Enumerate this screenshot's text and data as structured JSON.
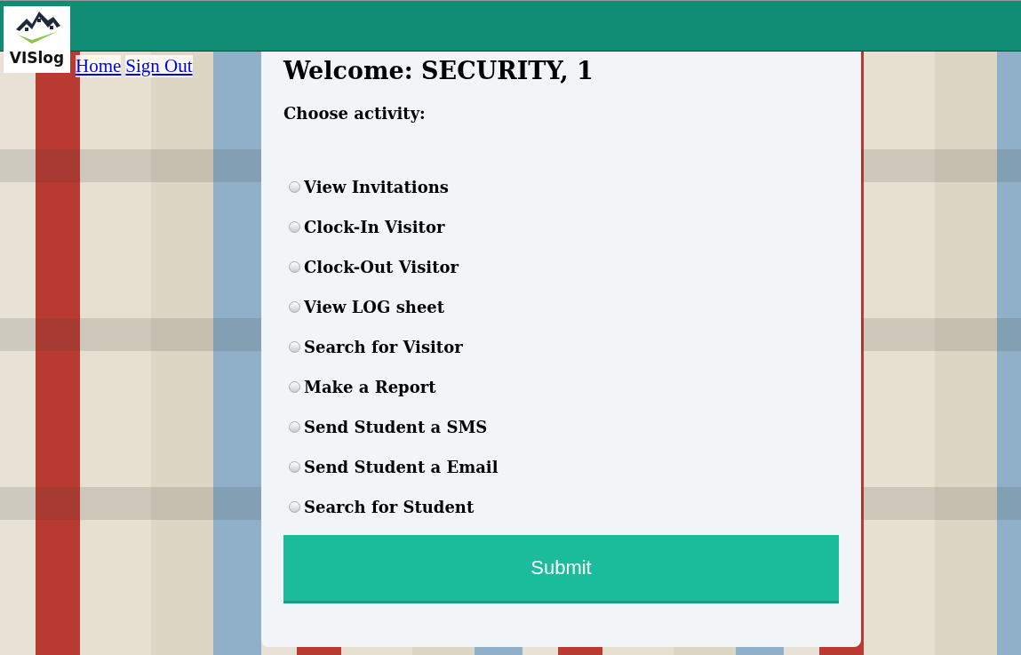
{
  "logo": {
    "text": "VISlog"
  },
  "nav_links": [
    "Home",
    "Sign Out"
  ],
  "welcome": "Welcome: SECURITY, 1",
  "prompt": "Choose activity:",
  "activities": [
    {
      "label": "View Invitations",
      "selected": false
    },
    {
      "label": "Clock-In Visitor",
      "selected": false
    },
    {
      "label": "Clock-Out Visitor",
      "selected": false
    },
    {
      "label": "View LOG sheet",
      "selected": false
    },
    {
      "label": "Search for Visitor",
      "selected": false
    },
    {
      "label": "Make a Report",
      "selected": false
    },
    {
      "label": "Send Student a SMS",
      "selected": false
    },
    {
      "label": "Send Student a Email",
      "selected": false
    },
    {
      "label": "Search for Student",
      "selected": false
    }
  ],
  "submit": "Submit"
}
